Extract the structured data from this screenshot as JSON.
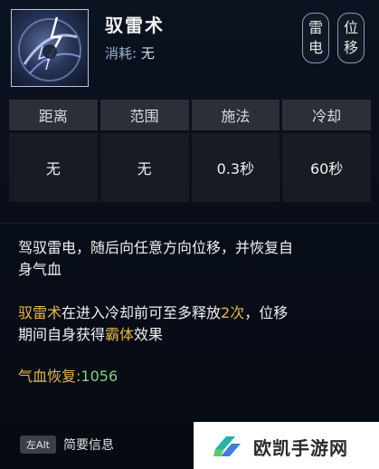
{
  "skill": {
    "name": "驭雷术",
    "cost_label": "消耗:",
    "cost_value": "无",
    "tags": [
      "雷电",
      "位移"
    ]
  },
  "stats": {
    "headers": [
      "距离",
      "范围",
      "施法",
      "冷却"
    ],
    "values": [
      "无",
      "无",
      "0.3秒",
      "60秒"
    ]
  },
  "description": {
    "line1": "驾驭雷电，随后向任意方向位移，并恢复自",
    "line2": "身气血",
    "para2_gold1": "驭雷术",
    "para2_text1": "在进入冷却前可至多释放",
    "para2_gold2": "2次",
    "para2_text2": "，位移",
    "para2_line2_text1": "期间自身获得",
    "para2_line2_gold": "霸体",
    "para2_line2_text2": "效果",
    "heal_label": "气血恢复:",
    "heal_value": "1056"
  },
  "footer": {
    "key_label": "左Alt",
    "info_label": "简要信息"
  },
  "watermark": {
    "text": "欧凯手游网"
  },
  "colors": {
    "gold": "#e6b64a",
    "green": "#7ed77e"
  }
}
